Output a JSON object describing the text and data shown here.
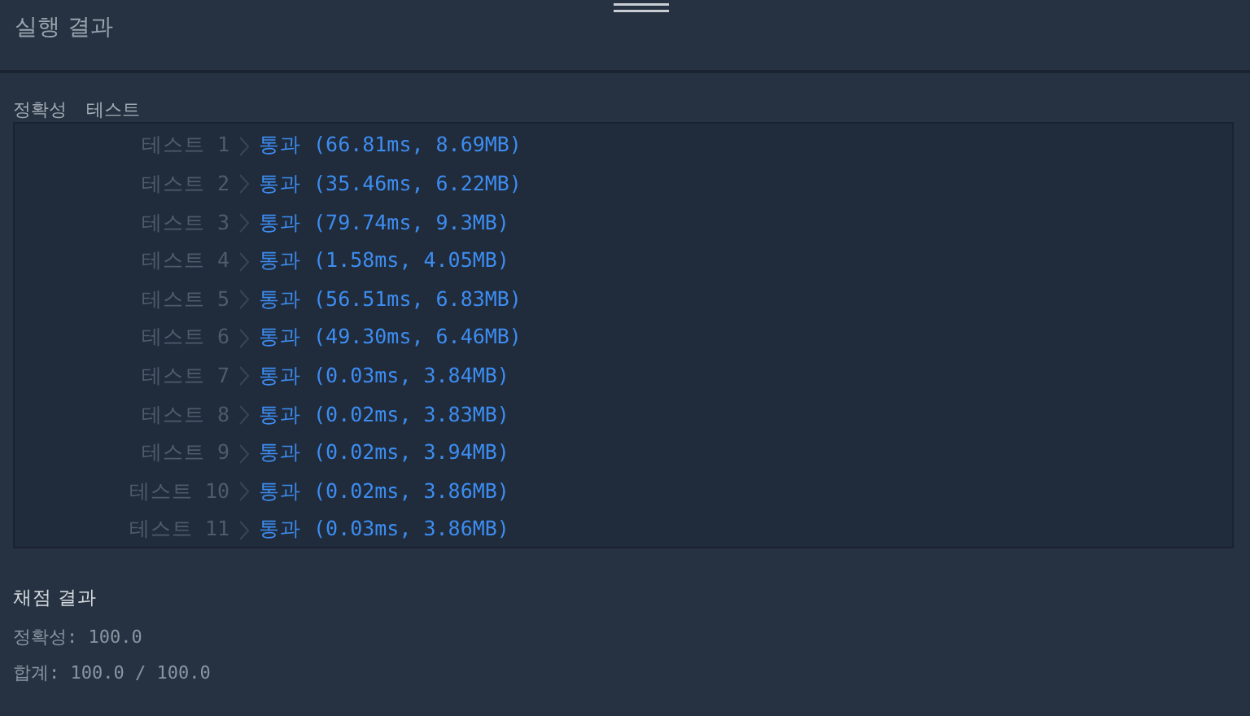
{
  "header": {
    "title": "실행 결과"
  },
  "section": {
    "labels": [
      "정확성",
      "테스트"
    ]
  },
  "tests": [
    {
      "label": "테스트 1",
      "result": "통과 (66.81ms, 8.69MB)"
    },
    {
      "label": "테스트 2",
      "result": "통과 (35.46ms, 6.22MB)"
    },
    {
      "label": "테스트 3",
      "result": "통과 (79.74ms, 9.3MB)"
    },
    {
      "label": "테스트 4",
      "result": "통과 (1.58ms, 4.05MB)"
    },
    {
      "label": "테스트 5",
      "result": "통과 (56.51ms, 6.83MB)"
    },
    {
      "label": "테스트 6",
      "result": "통과 (49.30ms, 6.46MB)"
    },
    {
      "label": "테스트 7",
      "result": "통과 (0.03ms, 3.84MB)"
    },
    {
      "label": "테스트 8",
      "result": "통과 (0.02ms, 3.83MB)"
    },
    {
      "label": "테스트 9",
      "result": "통과 (0.02ms, 3.94MB)"
    },
    {
      "label": "테스트 10",
      "result": "통과 (0.02ms, 3.86MB)"
    },
    {
      "label": "테스트 11",
      "result": "통과 (0.03ms, 3.86MB)"
    }
  ],
  "summary": {
    "title": "채점 결과",
    "lines": [
      "정확성: 100.0",
      "합계: 100.0 / 100.0"
    ]
  }
}
